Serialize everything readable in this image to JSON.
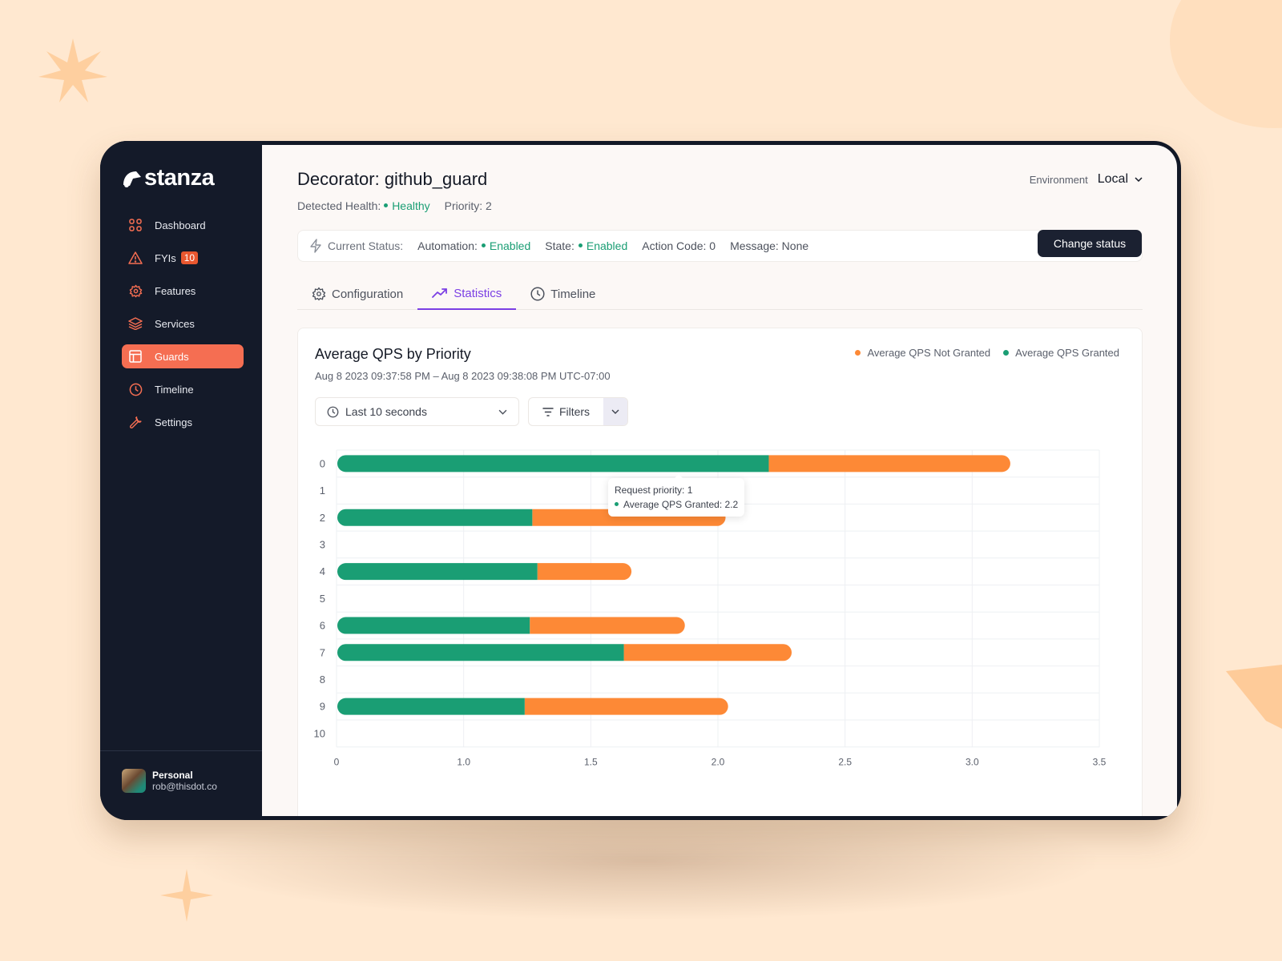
{
  "app": {
    "brand": "stanza"
  },
  "sidebar": {
    "items": [
      {
        "label": "Dashboard",
        "icon": "grid-icon"
      },
      {
        "label": "FYIs",
        "icon": "warning-icon",
        "badge": "10"
      },
      {
        "label": "Features",
        "icon": "gear-icon"
      },
      {
        "label": "Services",
        "icon": "layers-icon"
      },
      {
        "label": "Guards",
        "icon": "layout-icon",
        "active": true
      },
      {
        "label": "Timeline",
        "icon": "clock-icon"
      },
      {
        "label": "Settings",
        "icon": "wrench-icon"
      }
    ],
    "user": {
      "name": "Personal",
      "email": "rob@thisdot.co"
    }
  },
  "header": {
    "title": "Decorator: github_guard",
    "health_label": "Detected Health:",
    "health_value": "Healthy",
    "priority": "Priority: 2",
    "environment_label": "Environment",
    "environment_value": "Local"
  },
  "status": {
    "label": "Current Status:",
    "automation_label": "Automation:",
    "automation_value": "Enabled",
    "state_label": "State:",
    "state_value": "Enabled",
    "action_code": "Action Code: 0",
    "message": "Message: None",
    "change_button": "Change status"
  },
  "tabs": [
    {
      "label": "Configuration",
      "icon": "gear-icon"
    },
    {
      "label": "Statistics",
      "icon": "trending-up-icon",
      "active": true
    },
    {
      "label": "Timeline",
      "icon": "clock-icon"
    }
  ],
  "card": {
    "title": "Average QPS by Priority",
    "subtitle": "Aug 8 2023 09:37:58 PM – Aug 8 2023 09:38:08 PM UTC-07:00",
    "range_select": "Last 10 seconds",
    "filters_label": "Filters"
  },
  "colors": {
    "granted": "#1a9e74",
    "not_granted": "#fd8936",
    "accent": "#7b3fe4",
    "brand": "#f56e52"
  },
  "chart_data": {
    "type": "bar",
    "orientation": "horizontal",
    "stacked": true,
    "title": "Average QPS by Priority",
    "categories": [
      "0",
      "1",
      "2",
      "3",
      "4",
      "5",
      "6",
      "7",
      "8",
      "9",
      "10"
    ],
    "series": [
      {
        "name": "Average QPS Granted",
        "values": [
          2.2,
          0,
          1.27,
          0,
          1.29,
          0,
          1.26,
          1.63,
          0,
          1.24,
          0
        ]
      },
      {
        "name": "Average QPS Not Granted",
        "values": [
          0.95,
          0,
          0.76,
          0,
          0.37,
          0,
          0.61,
          0.66,
          0,
          0.8,
          0
        ]
      }
    ],
    "x_ticks": [
      "0",
      "1.0",
      "1.5",
      "2.0",
      "2.5",
      "3.0",
      "3.5"
    ],
    "x_tick_values": [
      0,
      1.0,
      1.5,
      2.0,
      2.5,
      3.0,
      3.5
    ],
    "xlim": [
      0,
      3.5
    ],
    "legend": [
      "Average QPS Not Granted",
      "Average QPS Granted"
    ],
    "legend_position": "top-right",
    "grid": true,
    "tooltip": {
      "title": "Request priority: 1",
      "line": "Average QPS Granted: 2.2"
    }
  }
}
